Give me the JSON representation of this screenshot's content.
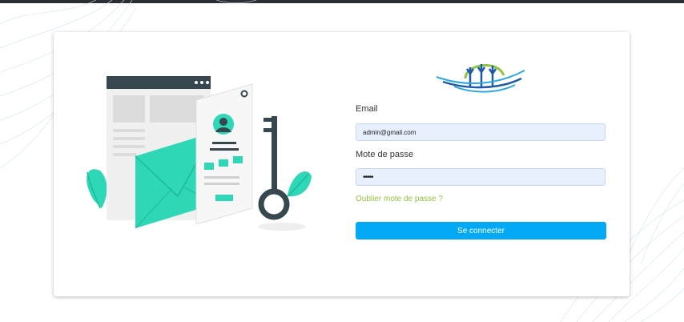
{
  "login": {
    "email_label": "Email",
    "email_value": "admin@gmail.com",
    "password_label": "Mote de passe",
    "password_value": "•••••",
    "forgot_link": "Oublier mote de passe ?",
    "submit_label": "Se connecter"
  },
  "icons": [
    "logo-waves-trees",
    "login-illustration-envelope-key"
  ],
  "colors": {
    "primary_button": "#03a9f4",
    "link": "#8cc63f",
    "input_bg": "#e8f0fe",
    "illustration_teal": "#2ed8b6",
    "illustration_dark": "#37474f",
    "background_lines": "#cfe6f7"
  }
}
